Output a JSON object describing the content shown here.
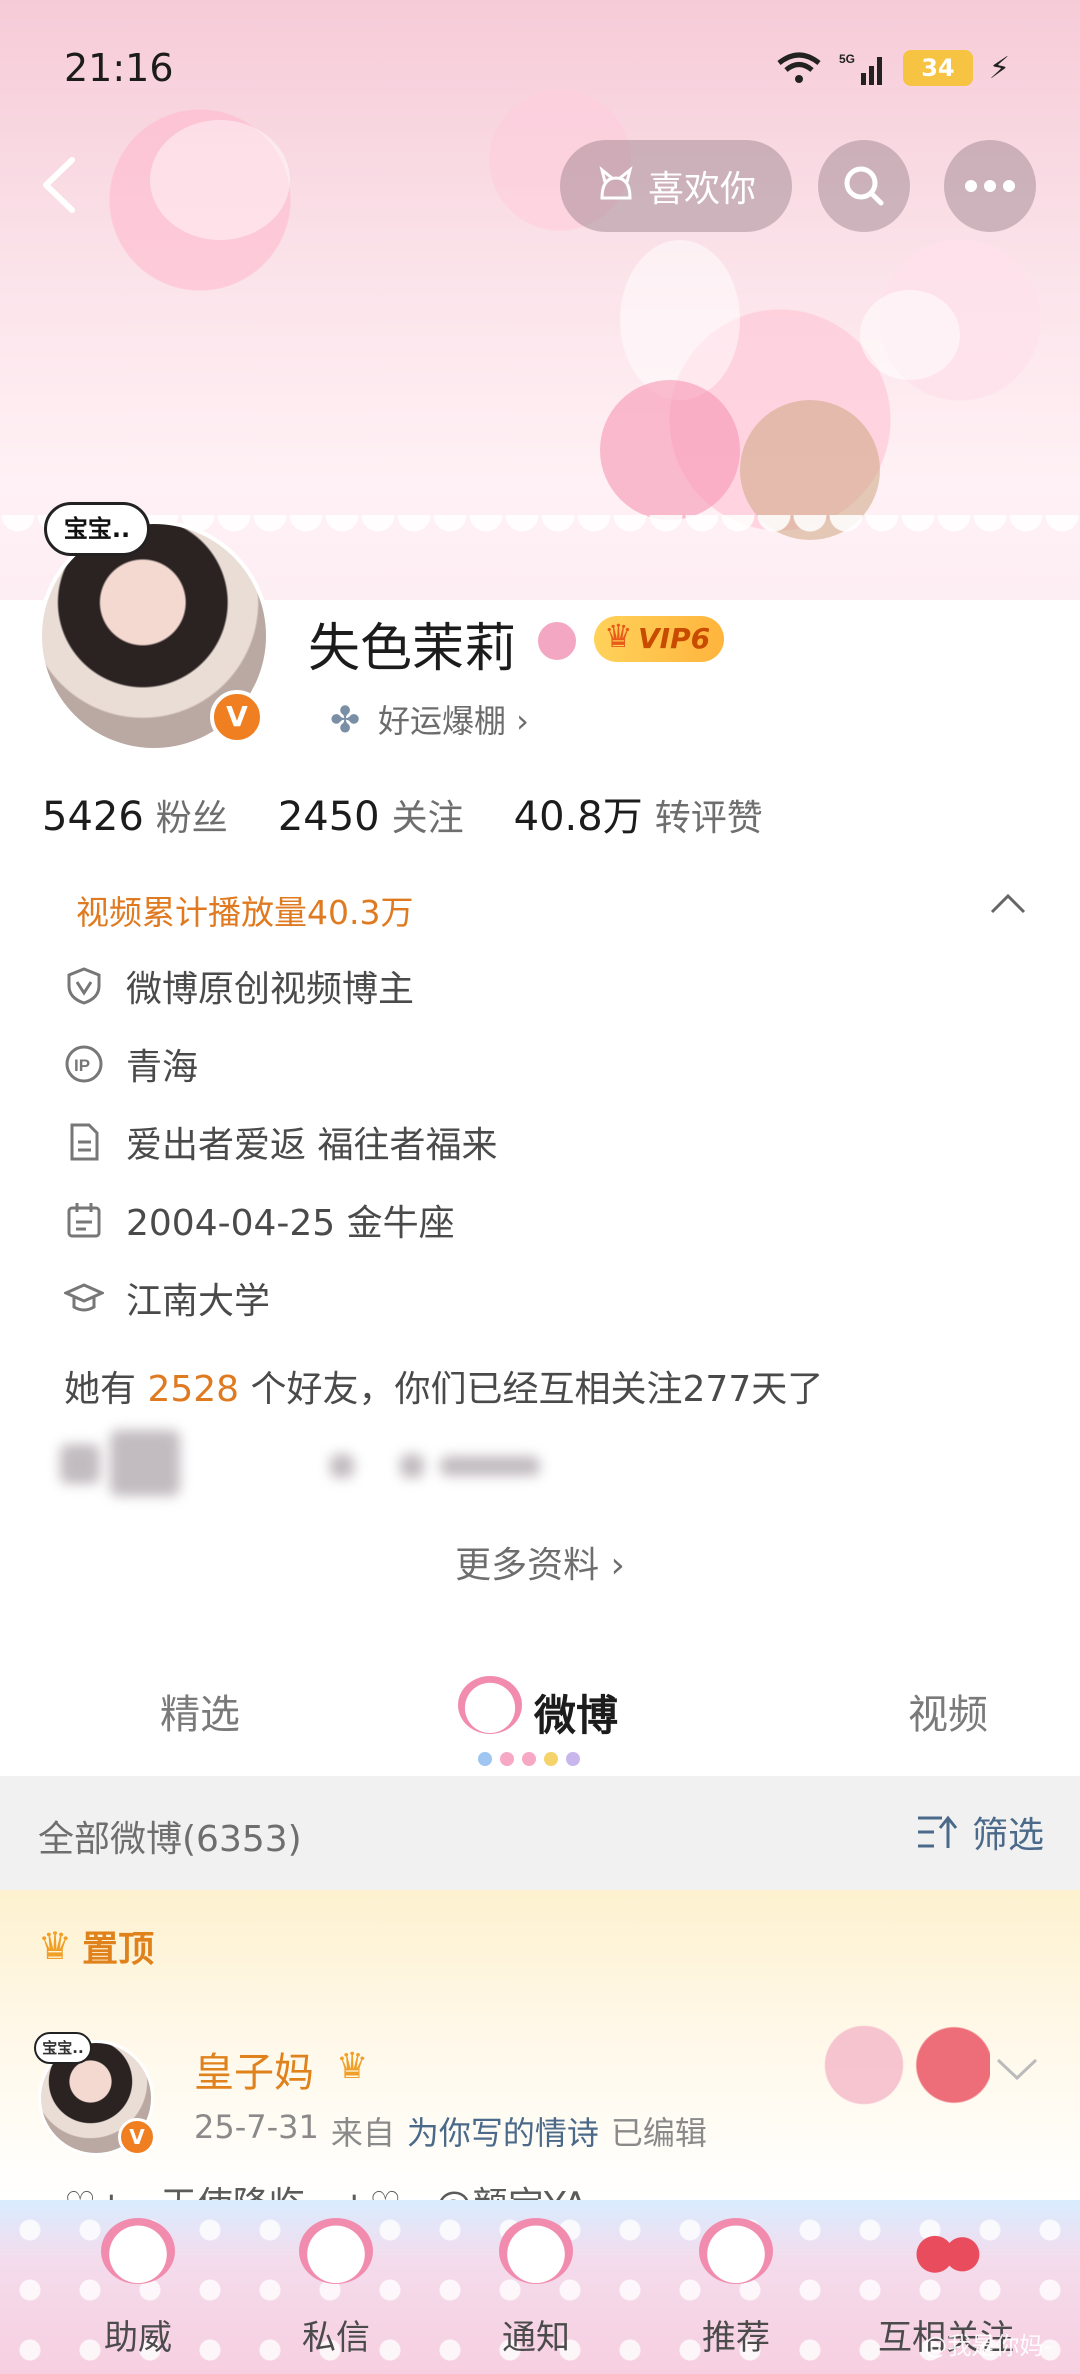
{
  "status_bar": {
    "time": "21:16",
    "network": "5G",
    "battery": "34"
  },
  "header": {
    "like_label": "喜欢你"
  },
  "profile": {
    "avatar_bubble": "宝宝..",
    "username": "失色茉莉",
    "vip": "VIP6",
    "luck_tag": "好运爆棚 ›",
    "stats": [
      {
        "num": "5426",
        "label": "粉丝"
      },
      {
        "num": "2450",
        "label": "关注"
      },
      {
        "num": "40.8万",
        "label": "转评赞"
      }
    ],
    "video_plays": "视频累计播放量40.3万",
    "info": [
      {
        "icon": "verified-shield-icon",
        "text": "微博原创视频博主"
      },
      {
        "icon": "ip-icon",
        "text": "青海"
      },
      {
        "icon": "document-icon",
        "text": "爱出者爱返 福往者福来"
      },
      {
        "icon": "calendar-icon",
        "text": "2004-04-25 金牛座"
      },
      {
        "icon": "graduation-cap-icon",
        "text": "江南大学"
      }
    ],
    "friends": {
      "prefix": "她有 ",
      "count": "2528",
      "suffix": " 个好友，你们已经互相关注277天了"
    },
    "more_info": "更多资料 ›"
  },
  "tabs": [
    {
      "label": "精选",
      "active": false
    },
    {
      "label": "微博",
      "active": true
    },
    {
      "label": "视频",
      "active": false
    }
  ],
  "feed": {
    "all_label": "全部微博(6353)",
    "filter_label": "筛选",
    "pin_label": "置顶",
    "post": {
      "avatar_bubble": "宝宝..",
      "author": "皇子妈",
      "date": "25-7-31",
      "from": "来自",
      "source": "为你写的情诗",
      "edited": "已编辑",
      "text_peek": "♡+ · 天使降临 · +♡ · @颜宝YA"
    }
  },
  "bottom_nav": [
    {
      "label": "助威"
    },
    {
      "label": "私信"
    },
    {
      "label": "通知"
    },
    {
      "label": "推荐"
    },
    {
      "label": "互相关注"
    }
  ],
  "watermark": "@我是你妈-",
  "colors": {
    "accent_orange": "#e07a21",
    "link_blue": "#4b6a8a",
    "banner_pink": "#f6cbd8"
  }
}
